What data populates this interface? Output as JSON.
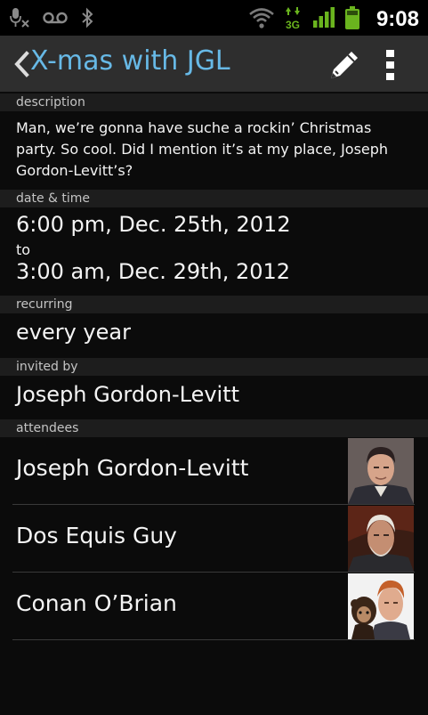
{
  "status_bar": {
    "time": "9:08",
    "network": "3G",
    "icons": [
      "mic-off-icon",
      "voicemail-icon",
      "bluetooth-icon",
      "wifi-icon",
      "data-3g-icon",
      "signal-icon",
      "battery-icon"
    ]
  },
  "action_bar": {
    "title": "X-mas with JGL",
    "title_color": "#67b9e6",
    "edit_icon": "pencil-icon",
    "overflow_icon": "overflow-menu-icon"
  },
  "sections": {
    "description": {
      "header": "description",
      "text": "Man, we’re gonna have suche a rockin’ Christmas party. So cool. Did I mention it’s at my place, Joseph Gordon-Levitt’s?"
    },
    "datetime": {
      "header": "date & time",
      "start": "6:00 pm, Dec. 25th, 2012",
      "separator": "to",
      "end": "3:00 am, Dec. 29th, 2012"
    },
    "recurring": {
      "header": "recurring",
      "value": "every year"
    },
    "invited_by": {
      "header": "invited by",
      "value": "Joseph Gordon-Levitt"
    },
    "attendees": {
      "header": "attendees",
      "items": [
        {
          "name": "Joseph Gordon-Levitt",
          "photo": "person-photo"
        },
        {
          "name": "Dos Equis Guy",
          "photo": "person-photo"
        },
        {
          "name": "Conan O’Brian",
          "photo": "person-with-monkey-photo"
        }
      ]
    }
  }
}
